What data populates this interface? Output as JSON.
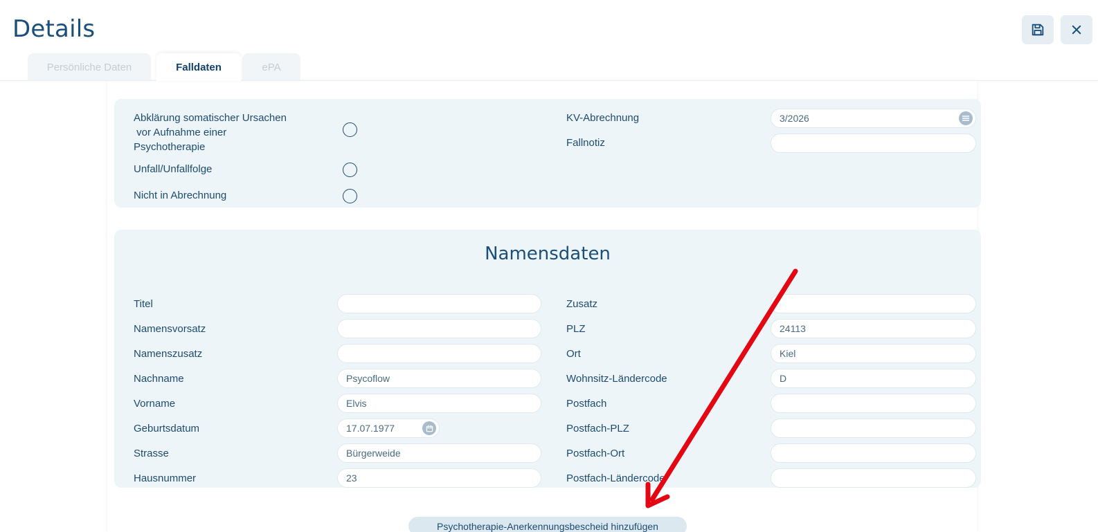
{
  "header": {
    "title": "Details",
    "save_icon": "save-icon",
    "close_icon": "close-icon"
  },
  "tabs": [
    {
      "label": "Persönliche Daten",
      "active": false
    },
    {
      "label": "Falldaten",
      "active": true
    },
    {
      "label": "ePA",
      "active": false
    }
  ],
  "case": {
    "somatic_label_line1": "Abklärung somatischer Ursachen",
    "somatic_label_line2": " vor Aufnahme einer",
    "somatic_label_line3": "Psychotherapie",
    "accident_label": "Unfall/Unfallfolge",
    "not_billing_label": "Nicht in Abrechnung",
    "kv_label": "KV-Abrechnung",
    "kv_value": "3/2026",
    "note_label": "Fallnotiz",
    "note_value": ""
  },
  "names": {
    "section_title": "Namensdaten",
    "left": [
      {
        "label": "Titel",
        "value": ""
      },
      {
        "label": "Namensvorsatz",
        "value": ""
      },
      {
        "label": "Namenszusatz",
        "value": ""
      },
      {
        "label": "Nachname",
        "value": "Psycoflow"
      },
      {
        "label": "Vorname",
        "value": "Elvis"
      },
      {
        "label": "Geburtsdatum",
        "value": "17.07.1977"
      },
      {
        "label": "Strasse",
        "value": "Bürgerweide"
      },
      {
        "label": "Hausnummer",
        "value": "23"
      }
    ],
    "right": [
      {
        "label": "Zusatz",
        "value": ""
      },
      {
        "label": "PLZ",
        "value": "24113"
      },
      {
        "label": "Ort",
        "value": "Kiel"
      },
      {
        "label": "Wohnsitz-Ländercode",
        "value": "D"
      },
      {
        "label": "Postfach",
        "value": ""
      },
      {
        "label": "Postfach-PLZ",
        "value": ""
      },
      {
        "label": "Postfach-Ort",
        "value": ""
      },
      {
        "label": "Postfach-Ländercode",
        "value": ""
      }
    ]
  },
  "actions": {
    "add_recognition_button": "Psychotherapie-Anerkennungsbescheid hinzufügen"
  },
  "colors": {
    "accent": "#1a4f7c",
    "panel_bg": "#eef5f8",
    "annotation_arrow": "#e30613"
  }
}
